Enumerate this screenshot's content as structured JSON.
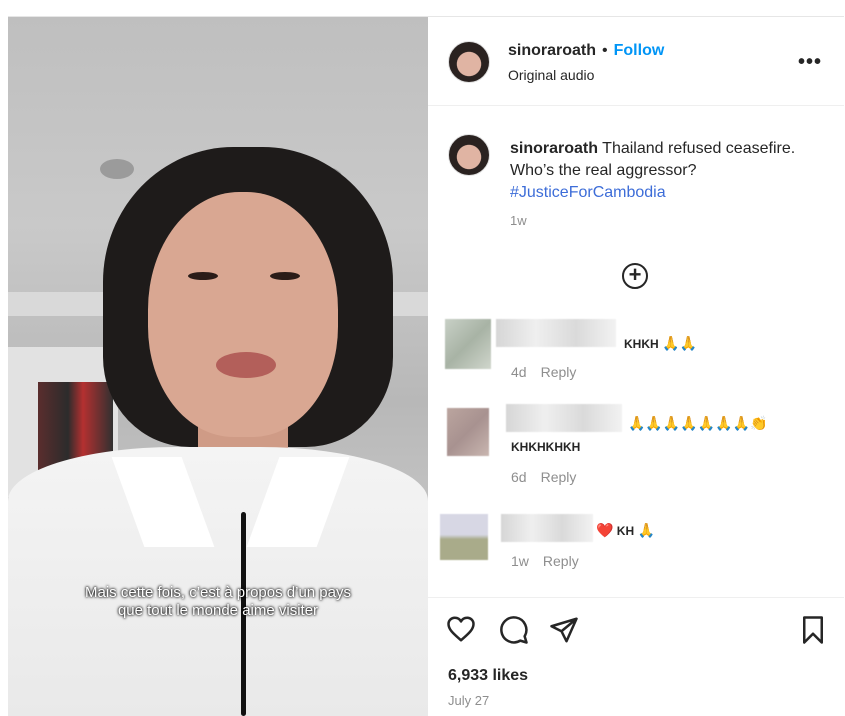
{
  "video": {
    "subtitle_line1": "Mais cette fois, c’est à propos d’un pays",
    "subtitle_line2": "que tout le monde aime visiter"
  },
  "header": {
    "username": "sinoraroath",
    "separator": "•",
    "follow_label": "Follow",
    "subtitle": "Original audio",
    "more_label": "•••"
  },
  "caption": {
    "username": "sinoraroath",
    "text_line1": " Thailand refused ceasefire.",
    "text_line2": "Who’s the real aggressor?",
    "hashtag": "#JusticeForCambodia",
    "time": "1w"
  },
  "load_more": {
    "icon": "plus-circle-icon",
    "label": "+"
  },
  "comments": [
    {
      "text": "KHKH",
      "emojis": "🙏🙏",
      "time": "4d",
      "reply": "Reply"
    },
    {
      "emojis": "🙏🙏🙏🙏🙏🙏🙏👏",
      "text": "KHKHKHKH",
      "time": "6d",
      "reply": "Reply"
    },
    {
      "emojis_before": "❤️",
      "text": "KH",
      "emojis": "🙏",
      "time": "1w",
      "reply": "Reply"
    }
  ],
  "actions": {
    "like_icon": "heart-icon",
    "comment_icon": "comment-icon",
    "share_icon": "send-icon",
    "save_icon": "bookmark-icon"
  },
  "likes": "6,933 likes",
  "date": "July 27",
  "colors": {
    "accent": "#0095f6",
    "hashtag": "#3d6dd8",
    "muted": "#8e8e8e"
  }
}
